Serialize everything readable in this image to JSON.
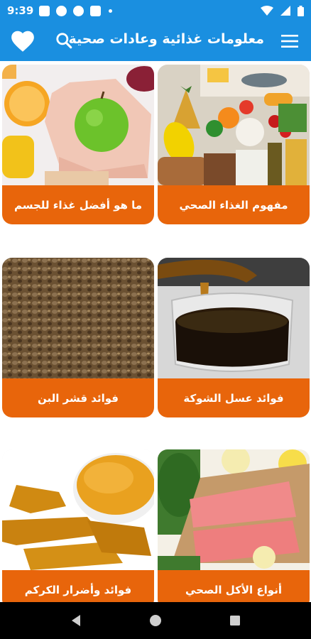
{
  "status_bar": {
    "time": "9:39"
  },
  "app_bar": {
    "title": "معلومات غذائية وعادات صحية",
    "accent_color": "#1a8fe0"
  },
  "cards": [
    {
      "label": "مفهوم الغذاء الصحي",
      "image": "healthy-food-assortment"
    },
    {
      "label": "ما هو أفضل غذاء للجسم",
      "image": "green-apple-in-hands"
    },
    {
      "label": "فوائد عسل الشوكة",
      "image": "honey-jar"
    },
    {
      "label": "فوائد قشر البن",
      "image": "coffee-husk"
    },
    {
      "label": "أنواع الأكل الصحي",
      "image": "salmon-fillets"
    },
    {
      "label": "فوائد وأضرار الكركم",
      "image": "turmeric"
    }
  ],
  "card_color": "#e8650b"
}
